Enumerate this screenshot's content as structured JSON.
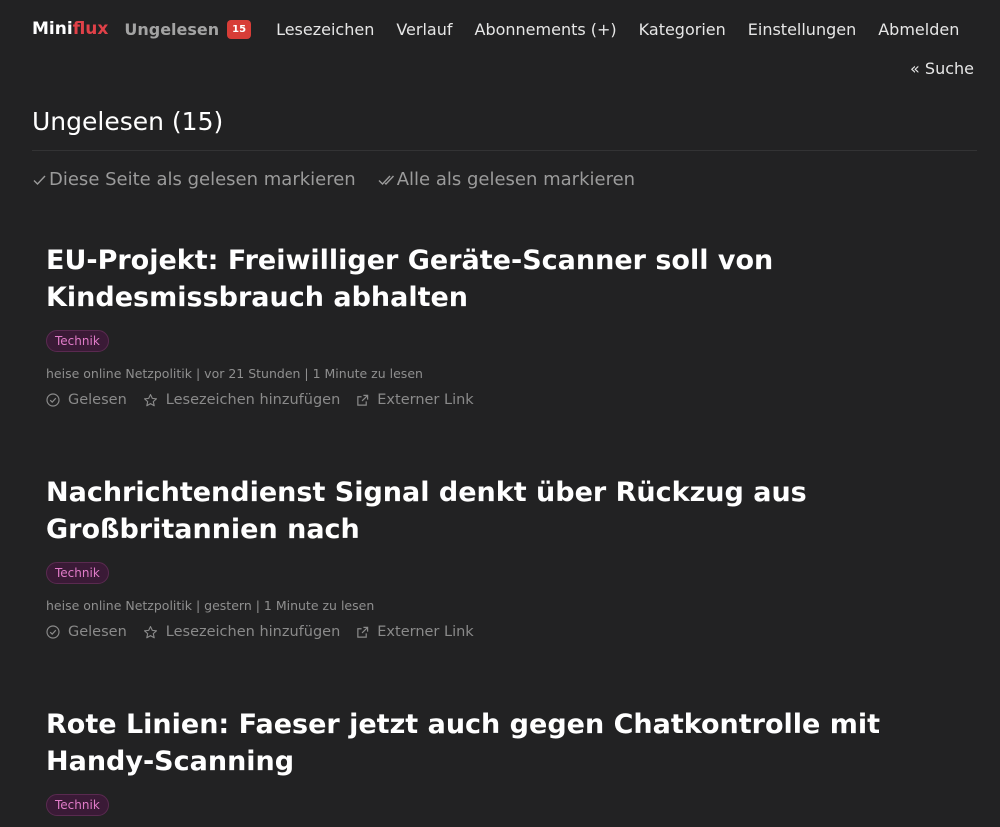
{
  "nav": {
    "logo_mini": "Mini",
    "logo_flux": "flux",
    "unread_label": "Ungelesen",
    "unread_count": "15",
    "items": [
      "Lesezeichen",
      "Verlauf",
      "Abonnements (+)",
      "Kategorien",
      "Einstellungen",
      "Abmelden"
    ],
    "search": "« Suche"
  },
  "page": {
    "title": "Ungelesen (15)",
    "mark_page_read": "Diese Seite als gelesen markieren",
    "mark_all_read": "Alle als gelesen markieren"
  },
  "entries": [
    {
      "title": "EU-Projekt: Freiwilliger Geräte-Scanner soll von Kindesmissbrauch abhalten",
      "category": "Technik",
      "meta": "heise online Netzpolitik | vor 21 Stunden | 1 Minute zu lesen"
    },
    {
      "title": "Nachrichtendienst Signal denkt über Rückzug aus Großbritannien nach",
      "category": "Technik",
      "meta": "heise online Netzpolitik | gestern | 1 Minute zu lesen"
    },
    {
      "title": "Rote Linien: Faeser jetzt auch gegen Chatkontrolle mit Handy-Scanning",
      "category": "Technik"
    }
  ],
  "entry_actions": {
    "read": "Gelesen",
    "bookmark": "Lesezeichen hinzufügen",
    "external": "Externer Link"
  },
  "colors": {
    "background": "#222223",
    "badge": "#d73d37",
    "logo_accent": "#e04148",
    "tag_text": "#e07bc8"
  }
}
